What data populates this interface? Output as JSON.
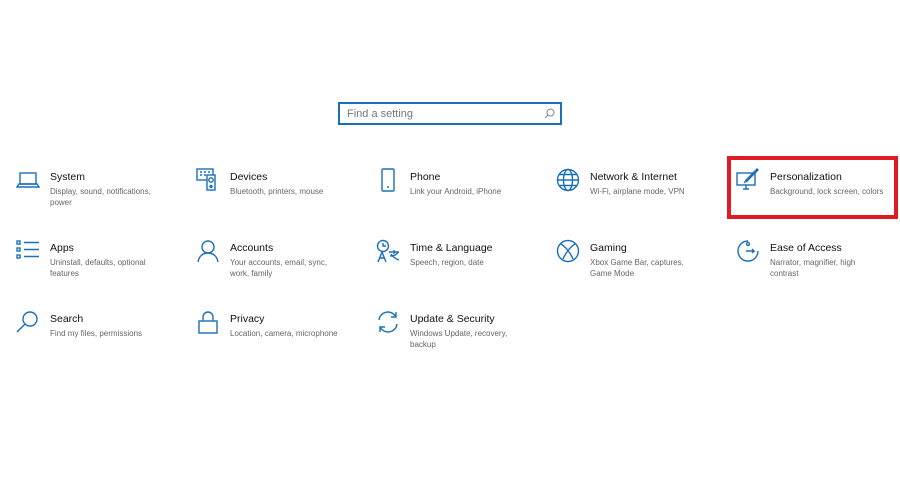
{
  "search": {
    "placeholder": "Find a setting",
    "icon": "search-icon"
  },
  "accent_color": "#1b6fb8",
  "highlight_color": "#e01b24",
  "highlighted_tile": "Personalization",
  "tiles": [
    {
      "title": "System",
      "desc": "Display, sound, notifications, power",
      "icon": "laptop-icon"
    },
    {
      "title": "Devices",
      "desc": "Bluetooth, printers, mouse",
      "icon": "devices-icon"
    },
    {
      "title": "Phone",
      "desc": "Link your Android, iPhone",
      "icon": "phone-icon"
    },
    {
      "title": "Network & Internet",
      "desc": "Wi-Fi, airplane mode, VPN",
      "icon": "globe-icon"
    },
    {
      "title": "Personalization",
      "desc": "Background, lock screen, colors",
      "icon": "personalization-icon"
    },
    {
      "title": "Apps",
      "desc": "Uninstall, defaults, optional features",
      "icon": "apps-list-icon"
    },
    {
      "title": "Accounts",
      "desc": "Your accounts, email, sync, work, family",
      "icon": "person-icon"
    },
    {
      "title": "Time & Language",
      "desc": "Speech, region, date",
      "icon": "time-language-icon"
    },
    {
      "title": "Gaming",
      "desc": "Xbox Game Bar, captures, Game Mode",
      "icon": "xbox-icon"
    },
    {
      "title": "Ease of Access",
      "desc": "Narrator, magnifier, high contrast",
      "icon": "ease-of-access-icon"
    },
    {
      "title": "Search",
      "desc": "Find my files, permissions",
      "icon": "search-icon"
    },
    {
      "title": "Privacy",
      "desc": "Location, camera, microphone",
      "icon": "lock-icon"
    },
    {
      "title": "Update & Security",
      "desc": "Windows Update, recovery, backup",
      "icon": "sync-icon"
    }
  ]
}
